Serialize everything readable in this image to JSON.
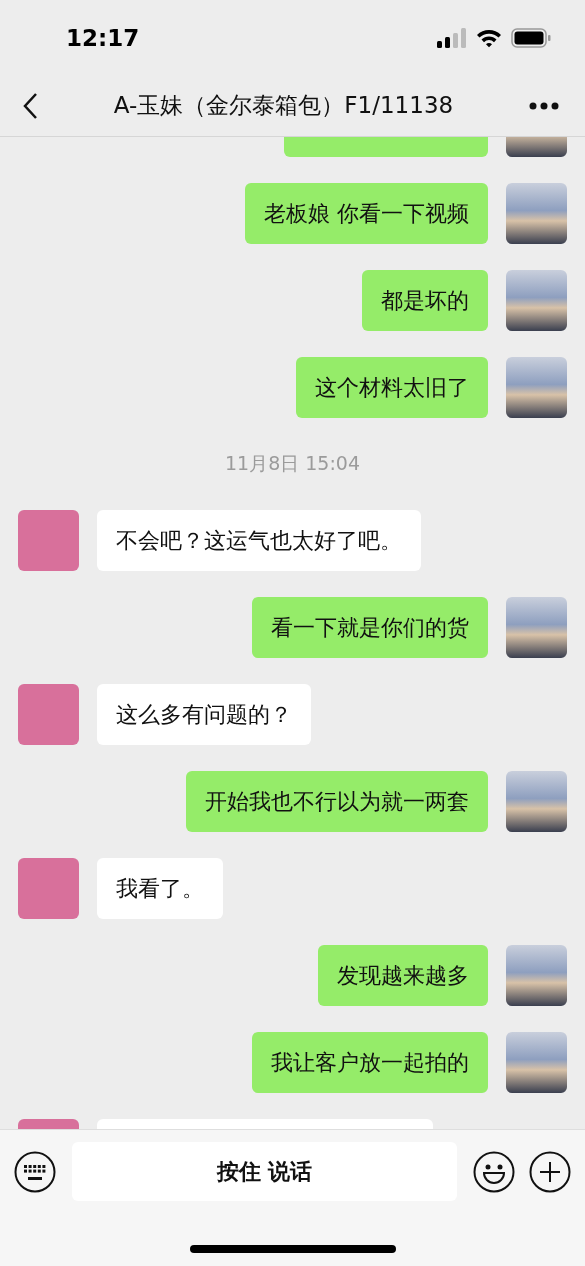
{
  "status_bar": {
    "time": "12:17"
  },
  "header": {
    "title": "A-玉妹（金尔泰箱包）F1/11138"
  },
  "messages": [
    {
      "kind": "sent",
      "cut": true
    },
    {
      "kind": "sent",
      "text": "老板娘 你看一下视频"
    },
    {
      "kind": "sent",
      "text": "都是坏的"
    },
    {
      "kind": "sent",
      "text": "这个材料太旧了"
    },
    {
      "kind": "time",
      "text": "11月8日 15:04"
    },
    {
      "kind": "received",
      "text": "不会吧？这运气也太好了吧。"
    },
    {
      "kind": "sent",
      "text": "看一下就是你们的货"
    },
    {
      "kind": "received",
      "text": "这么多有问题的？"
    },
    {
      "kind": "sent",
      "text": "开始我也不行以为就一两套"
    },
    {
      "kind": "received",
      "text": "我看了。"
    },
    {
      "kind": "sent",
      "text": "发现越来越多"
    },
    {
      "kind": "sent",
      "text": "我让客户放一起拍的"
    },
    {
      "kind": "received",
      "cut": true
    }
  ],
  "input_bar": {
    "voice_button": "按住 说话"
  }
}
